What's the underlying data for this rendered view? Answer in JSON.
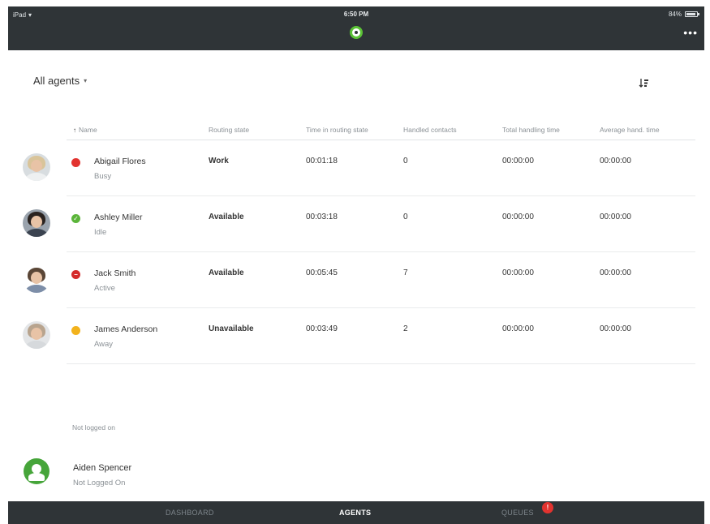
{
  "status_bar": {
    "carrier": "iPad",
    "time": "6:50 PM",
    "battery": "84%"
  },
  "header": {
    "logo_icon": "app-logo-icon",
    "menu_icon": "more-icon",
    "menu_label": "•••"
  },
  "filter": {
    "label": "All agents",
    "caret": "▾"
  },
  "table": {
    "sort_icon": "↑",
    "columns": [
      "Name",
      "Routing state",
      "Time in routing state",
      "Handled contacts",
      "Total handling time",
      "Average hand. time"
    ],
    "rows": [
      {
        "name": "Abigail Flores",
        "presence": "Busy",
        "routing_state": "Work",
        "time_in_state": "00:01:18",
        "handled": "0",
        "total_time": "00:00:00",
        "avg_time": "00:00:00",
        "status_color": "#e2332f",
        "status_symbol": "",
        "avatar_colors": {
          "hair": "#d9c49a",
          "body": "#eef0f1",
          "bg": "#d8dde0"
        }
      },
      {
        "name": "Ashley Miller",
        "presence": "Idle",
        "routing_state": "Available",
        "time_in_state": "00:03:18",
        "handled": "0",
        "total_time": "00:00:00",
        "avg_time": "00:00:00",
        "status_color": "#5bb53a",
        "status_symbol": "✓",
        "avatar_colors": {
          "hair": "#2a2320",
          "body": "#3b4350",
          "bg": "#9aa3ad"
        }
      },
      {
        "name": "Jack Smith",
        "presence": "Active",
        "routing_state": "Available",
        "time_in_state": "00:05:45",
        "handled": "7",
        "total_time": "00:00:00",
        "avg_time": "00:00:00",
        "status_color": "#d42a2a",
        "status_symbol": "−",
        "avatar_colors": {
          "hair": "#5a4636",
          "body": "#7d8ea8",
          "bg": "#ffffff"
        }
      },
      {
        "name": "James Anderson",
        "presence": "Away",
        "routing_state": "Unavailable",
        "time_in_state": "00:03:49",
        "handled": "2",
        "total_time": "00:00:00",
        "avg_time": "00:00:00",
        "status_color": "#f2b21c",
        "status_symbol": "",
        "avatar_colors": {
          "hair": "#b8a48e",
          "body": "#d6d9dc",
          "bg": "#e3e5e7"
        }
      }
    ]
  },
  "not_logged_on": {
    "section_label": "Not logged on",
    "agent_name": "Aiden Spencer",
    "agent_status": "Not Logged On",
    "avatar_color": "#46a53a"
  },
  "tabs": {
    "dashboard": "DASHBOARD",
    "agents": "AGENTS",
    "queues": "QUEUES",
    "queues_badge": "!"
  }
}
